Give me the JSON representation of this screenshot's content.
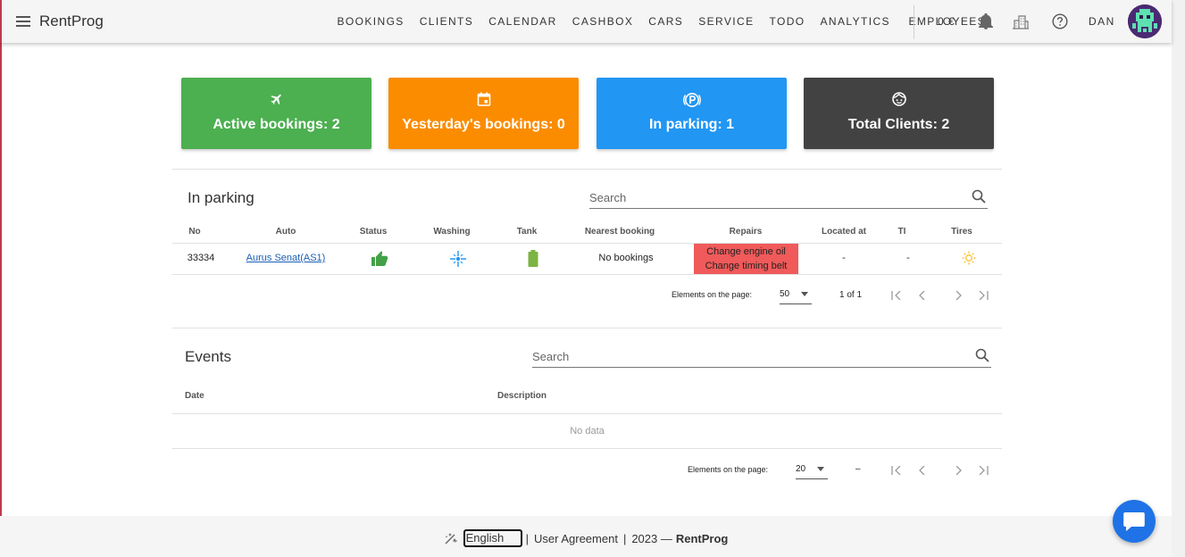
{
  "appbar": {
    "brand": "RentProg",
    "nav": [
      "BOOKINGS",
      "CLIENTS",
      "CALENDAR",
      "CASHBOX",
      "CARS",
      "SERVICE",
      "TODO",
      "ANALYTICS",
      "EMPLOYEES"
    ],
    "balance": "0 €",
    "user": "DAN"
  },
  "cards": [
    {
      "label": "Active bookings: 2",
      "color": "#4caf50",
      "icon": "airplane-icon"
    },
    {
      "label": "Yesterday's bookings: 0",
      "color": "#fb8c00",
      "icon": "calendar-icon"
    },
    {
      "label": "In parking: 1",
      "color": "#2196f3",
      "icon": "parking-icon"
    },
    {
      "label": "Total Clients: 2",
      "color": "#424242",
      "icon": "face-icon"
    }
  ],
  "parking": {
    "title": "In parking",
    "search_placeholder": "Search",
    "columns": [
      "No",
      "Auto",
      "Status",
      "Washing",
      "Tank",
      "Nearest booking",
      "Repairs",
      "Located at",
      "TI",
      "Tires"
    ],
    "row": {
      "no": "33334",
      "auto": "Aurus Senat(AS1)",
      "nearest_booking": "No bookings",
      "repairs": [
        "Change engine oil",
        "Change timing belt"
      ],
      "located_at": "-",
      "ti": "-"
    },
    "pagination": {
      "label": "Elements on the page:",
      "per_page": "50",
      "range": "1 of 1"
    }
  },
  "events": {
    "title": "Events",
    "search_placeholder": "Search",
    "columns": [
      "Date",
      "Description"
    ],
    "empty": "No data",
    "pagination": {
      "label": "Elements on the page:",
      "per_page": "20",
      "range": "–"
    }
  },
  "footer": {
    "language": "English",
    "agreement": "User Agreement",
    "year": "2023 —",
    "brand": "RentProg"
  },
  "colors": {
    "green": "#4caf50",
    "orange": "#fb8c00",
    "blue": "#2196f3",
    "dark": "#424242",
    "repair_red": "#f05a5a"
  }
}
